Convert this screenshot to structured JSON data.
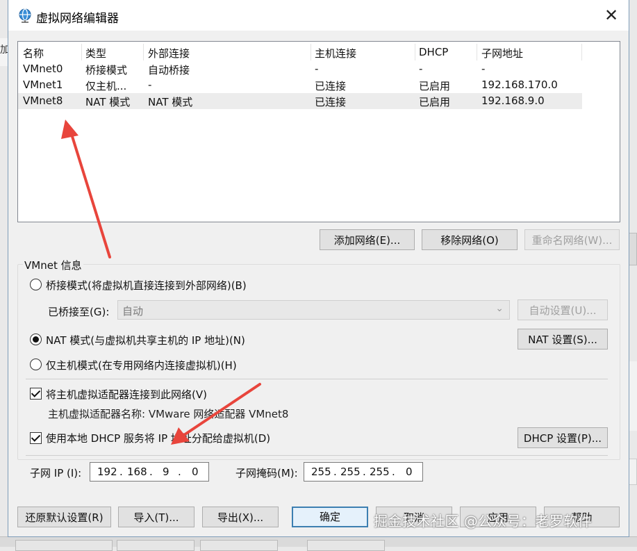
{
  "window": {
    "title": "虚拟网络编辑器"
  },
  "background": {
    "left_char": "加"
  },
  "network_list": {
    "headers": [
      "名称",
      "类型",
      "外部连接",
      "主机连接",
      "DHCP",
      "子网地址"
    ],
    "rows": [
      [
        "VMnet0",
        "桥接模式",
        "自动桥接",
        "-",
        "-",
        "-"
      ],
      [
        "VMnet1",
        "仅主机...",
        "-",
        "已连接",
        "已启用",
        "192.168.170.0"
      ],
      [
        "VMnet8",
        "NAT 模式",
        "NAT 模式",
        "已连接",
        "已启用",
        "192.168.9.0"
      ]
    ],
    "selected_index": 2
  },
  "list_buttons": {
    "add": "添加网络(E)...",
    "remove": "移除网络(O)",
    "rename": "重命名网络(W)..."
  },
  "vmnet_info": {
    "group_title": "VMnet 信息",
    "bridged_label": "桥接模式(将虚拟机直接连接到外部网络)(B)",
    "bridged_to_label": "已桥接至(G):",
    "bridged_to_value": "自动",
    "auto_settings": "自动设置(U)...",
    "nat_label": "NAT 模式(与虚拟机共享主机的 IP 地址)(N)",
    "nat_settings": "NAT 设置(S)...",
    "hostonly_label": "仅主机模式(在专用网络内连接虚拟机)(H)",
    "selected_mode": "nat",
    "connect_adapter_label": "将主机虚拟适配器连接到此网络(V)",
    "connect_adapter_checked": true,
    "adapter_name_text": "主机虚拟适配器名称: VMware 网络适配器 VMnet8",
    "dhcp_label": "使用本地 DHCP 服务将 IP 地址分配给虚拟机(D)",
    "dhcp_checked": true,
    "dhcp_settings": "DHCP 设置(P)...",
    "subnet_ip_label": "子网 IP (I):",
    "subnet_ip": [
      "192",
      "168",
      "9",
      "0"
    ],
    "subnet_mask_label": "子网掩码(M):",
    "subnet_mask": [
      "255",
      "255",
      "255",
      "0"
    ]
  },
  "footer_buttons": {
    "restore": "还原默认设置(R)",
    "import": "导入(T)...",
    "export": "导出(X)...",
    "ok": "确定",
    "cancel": "取消",
    "apply": "应用",
    "help": "帮助"
  },
  "watermark": "掘金技术社区 @公众号：老罗软件",
  "colors": {
    "annotation_arrow": "#e8453c",
    "default_button_border": "#3c7fb1"
  }
}
